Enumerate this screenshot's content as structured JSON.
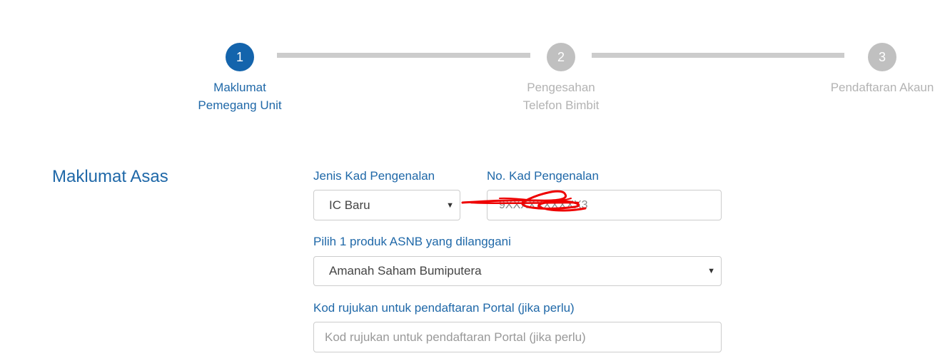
{
  "stepper": {
    "steps": [
      {
        "number": "1",
        "label": "Maklumat Pemegang Unit",
        "state": "active"
      },
      {
        "number": "2",
        "label": "Pengesahan Telefon Bimbit",
        "state": "inactive"
      },
      {
        "number": "3",
        "label": "Pendaftaran Akaun",
        "state": "inactive"
      }
    ]
  },
  "form": {
    "section_title": "Maklumat Asas",
    "id_type": {
      "label": "Jenis Kad Pengenalan",
      "selected": "IC Baru"
    },
    "id_number": {
      "label": "No. Kad Pengenalan",
      "value": "9XXXXXXXXXX3"
    },
    "product": {
      "label": "Pilih 1 produk ASNB yang dilanggani",
      "selected": "Amanah Saham Bumiputera"
    },
    "referral": {
      "label": "Kod rujukan untuk pendaftaran Portal (jika perlu)",
      "placeholder": "Kod rujukan untuk pendaftaran Portal (jika perlu)"
    }
  },
  "colors": {
    "primary": "#1464ac",
    "label": "#1f68a8",
    "inactive": "#c0c0c0",
    "redaction": "#ee0000"
  },
  "icons": {
    "select_caret": "caret-down-icon"
  }
}
